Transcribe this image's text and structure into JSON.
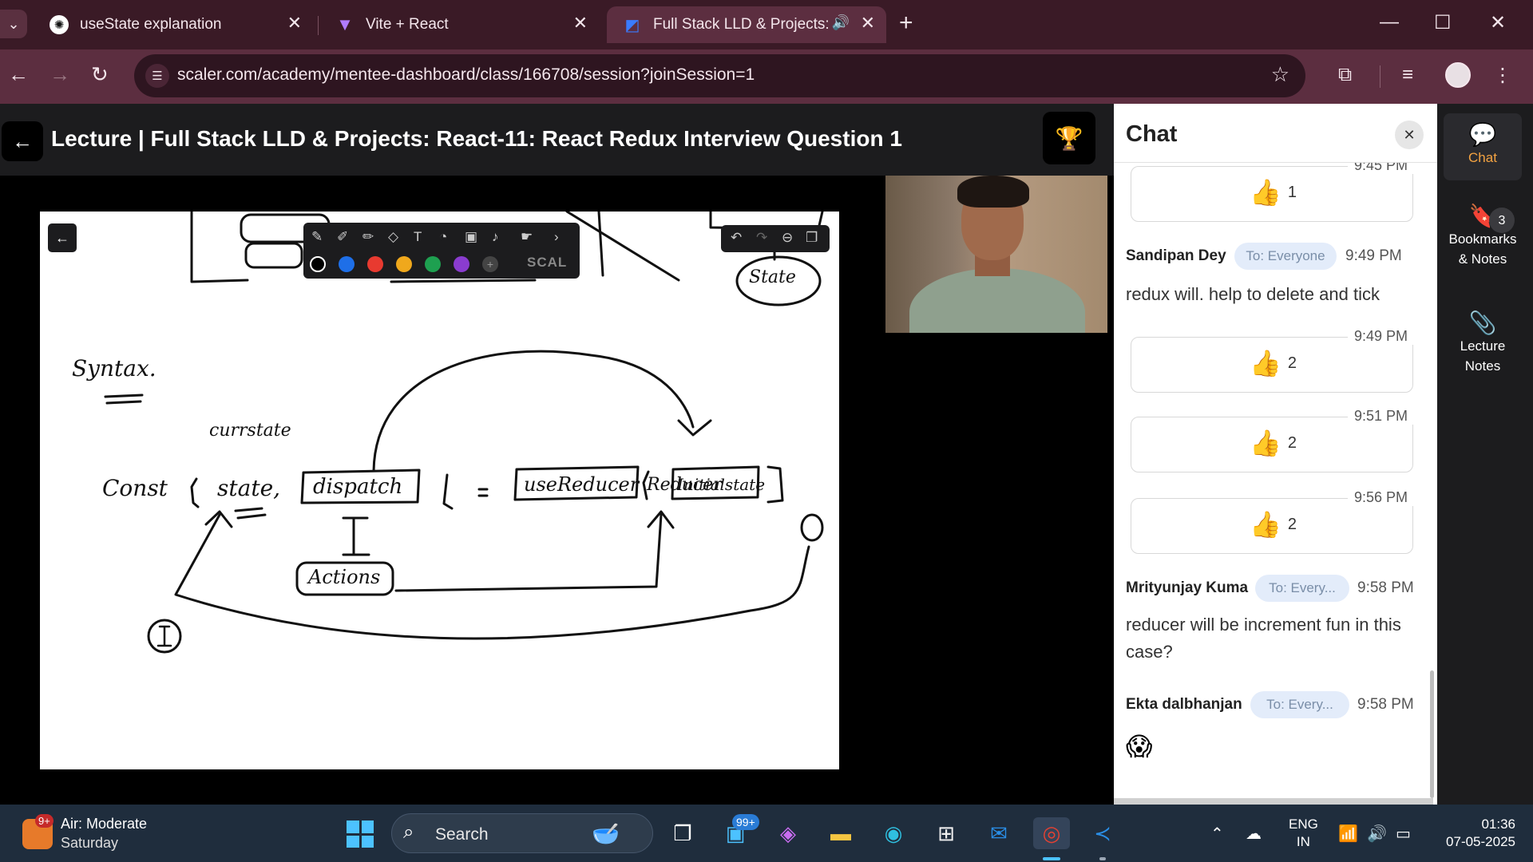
{
  "browser": {
    "tabs": [
      {
        "title": "useState explanation",
        "active": false
      },
      {
        "title": "Vite + React",
        "active": false
      },
      {
        "title": "Full Stack LLD & Projects: Re",
        "active": true
      }
    ],
    "url": "scaler.com/academy/mentee-dashboard/class/166708/session?joinSession=1",
    "icons": {
      "tab_menu": "chevron-down-icon",
      "new_tab": "plus-icon",
      "minimize": "minimize-icon",
      "maximize": "maximize-icon",
      "close": "close-icon",
      "back": "arrow-left-icon",
      "forward": "arrow-right-icon",
      "reload": "reload-icon",
      "site_info": "tune-icon",
      "bookmark": "star-icon",
      "extensions": "puzzle-icon",
      "media": "media-control-icon",
      "menu": "kebab-menu-icon"
    },
    "colors": {
      "frame": "#3a1a26",
      "toolbar": "#5c2e40",
      "omnibox": "#2e1520"
    }
  },
  "lecture": {
    "title": "Lecture | Full Stack LLD & Projects: React-11: React Redux Interview Question 1"
  },
  "whiteboard": {
    "brand": "SCAL",
    "colors": [
      "#000000",
      "#1e6fe8",
      "#e83a30",
      "#f0a81c",
      "#1ea050",
      "#8a3ccf"
    ]
  },
  "chat": {
    "title": "Chat",
    "messages": [
      {
        "kind": "reaction",
        "time": "9:45 PM",
        "emoji": "👍",
        "count": "1"
      },
      {
        "kind": "text",
        "sender": "Sandipan Dey",
        "to": "To: Everyone",
        "time": "9:49 PM",
        "text": "redux will. help to delete and tick"
      },
      {
        "kind": "reaction",
        "time": "9:49 PM",
        "emoji": "👍",
        "count": "2"
      },
      {
        "kind": "reaction",
        "time": "9:51 PM",
        "emoji": "👍",
        "count": "2"
      },
      {
        "kind": "reaction",
        "time": "9:56 PM",
        "emoji": "👍",
        "count": "2"
      },
      {
        "kind": "text",
        "sender": "Mrityunjay Kuma",
        "to": "To: Every...",
        "time": "9:58 PM",
        "text": "reducer will be increment fun in this case?"
      },
      {
        "kind": "text",
        "sender": "Ekta dalbhanjan",
        "to": "To: Every...",
        "time": "9:58 PM",
        "text": "😱"
      }
    ]
  },
  "rail": {
    "chat_label": "Chat",
    "bookmarks_line1": "Bookmarks",
    "bookmarks_line2": "& Notes",
    "bookmarks_count": "3",
    "notes_line1": "Lecture",
    "notes_line2": "Notes",
    "accent": "#f4a342"
  },
  "taskbar": {
    "weather_badge": "9+",
    "weather_title": "Air: Moderate",
    "weather_sub": "Saturday",
    "search_label": "Search",
    "mail_badge": "99+",
    "lang_line1": "ENG",
    "lang_line2": "IN",
    "time": "01:36",
    "date": "07-05-2025"
  }
}
